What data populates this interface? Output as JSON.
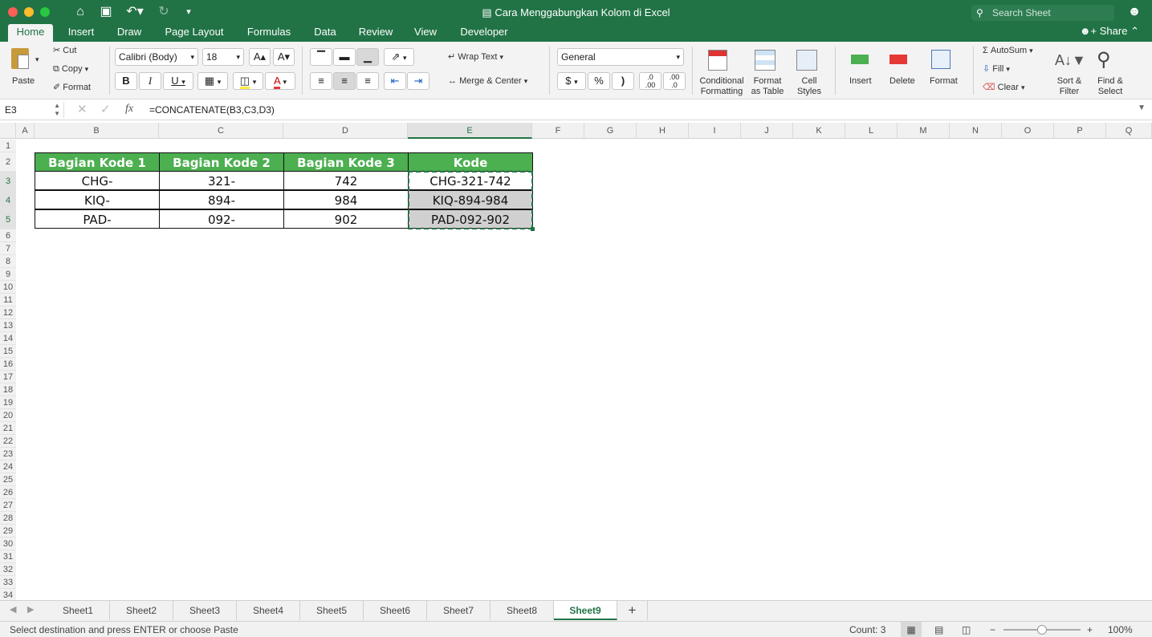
{
  "window": {
    "title": "Cara Menggabungkan Kolom di Excel",
    "search_placeholder": "Search Sheet"
  },
  "ribbon_tabs": [
    "Home",
    "Insert",
    "Draw",
    "Page Layout",
    "Formulas",
    "Data",
    "Review",
    "View",
    "Developer"
  ],
  "share_label": "Share",
  "clipboard": {
    "paste": "Paste",
    "cut": "Cut",
    "copy": "Copy",
    "format": "Format"
  },
  "font": {
    "name": "Calibri (Body)",
    "size": "18",
    "bold": "B",
    "italic": "I",
    "underline": "U"
  },
  "alignment": {
    "wrap": "Wrap Text",
    "merge": "Merge & Center"
  },
  "number": {
    "format": "General",
    "currency": "$",
    "percent": "%",
    "comma": ")",
    "inc": ".0\n.00",
    "dec": ".00\n.0"
  },
  "styles": {
    "conditional": "Conditional",
    "conditional2": "Formatting",
    "format_table": "Format",
    "format_table2": "as Table",
    "cell_styles": "Cell",
    "cell_styles2": "Styles"
  },
  "cells_group": {
    "insert": "Insert",
    "delete": "Delete",
    "format": "Format"
  },
  "editing": {
    "autosum": "AutoSum",
    "fill": "Fill",
    "clear": "Clear",
    "sort": "Sort &",
    "sort2": "Filter",
    "find": "Find &",
    "find2": "Select"
  },
  "formula_bar": {
    "cell_ref": "E3",
    "fx": "fx",
    "formula": "=CONCATENATE(B3,C3,D3)"
  },
  "columns": [
    "A",
    "B",
    "C",
    "D",
    "E",
    "F",
    "G",
    "H",
    "I",
    "J",
    "K",
    "L",
    "M",
    "N",
    "O",
    "P",
    "Q"
  ],
  "rows": [
    "1",
    "2",
    "3",
    "4",
    "5",
    "6",
    "7",
    "8",
    "9",
    "10",
    "11",
    "12",
    "13",
    "14",
    "15",
    "16",
    "17",
    "18",
    "19",
    "20",
    "21",
    "22",
    "23",
    "24",
    "25",
    "26",
    "27",
    "28",
    "29",
    "30",
    "31",
    "32",
    "33",
    "34"
  ],
  "table": {
    "headers": [
      "Bagian Kode 1",
      "Bagian Kode 2",
      "Bagian Kode 3",
      "Kode"
    ],
    "rows": [
      [
        "CHG-",
        "321-",
        "742",
        "CHG-321-742"
      ],
      [
        "KIQ-",
        "894-",
        "984",
        "KIQ-894-984"
      ],
      [
        "PAD-",
        "092-",
        "902",
        "PAD-092-902"
      ]
    ]
  },
  "sheets": [
    "Sheet1",
    "Sheet2",
    "Sheet3",
    "Sheet4",
    "Sheet5",
    "Sheet6",
    "Sheet7",
    "Sheet8",
    "Sheet9"
  ],
  "active_sheet": "Sheet9",
  "status": {
    "message": "Select destination and press ENTER or choose Paste",
    "count": "Count: 3",
    "zoom": "100%"
  },
  "colors": {
    "accent": "#217346",
    "header_fill": "#4caf50",
    "selected_fill": "#d0d0d0"
  }
}
